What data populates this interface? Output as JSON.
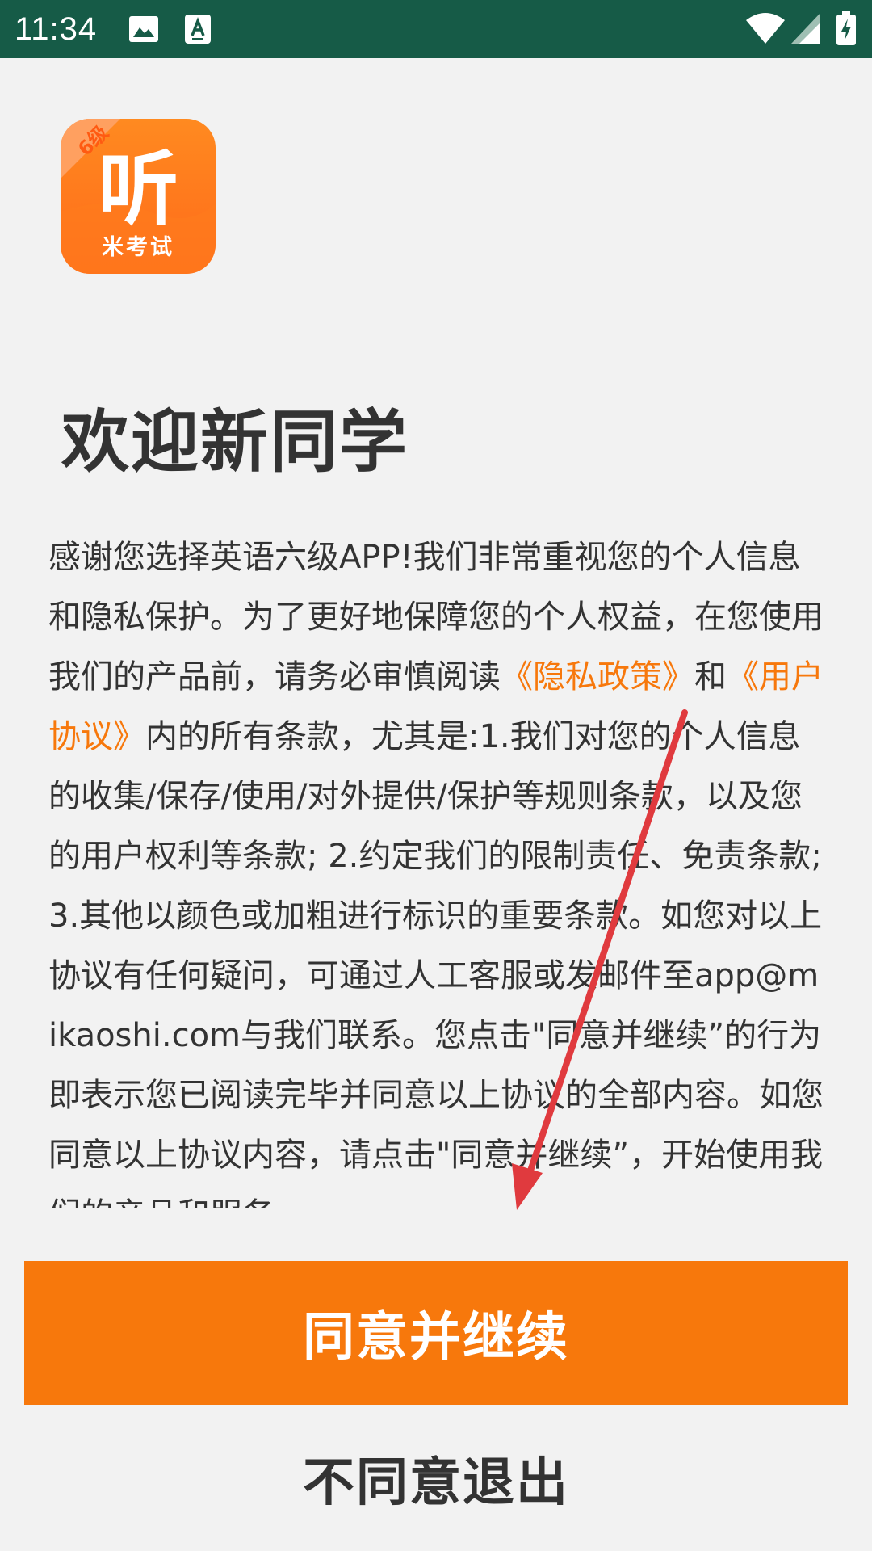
{
  "status_bar": {
    "time": "11:34",
    "icons": [
      "image-icon",
      "text-format-icon",
      "wifi-icon",
      "cellular-signal-icon",
      "battery-charging-icon"
    ]
  },
  "app": {
    "logo_icon": "listening-6-level-app-logo",
    "logo_badge": "6级",
    "logo_main": "听",
    "logo_sub": "米考试"
  },
  "welcome": {
    "title": "欢迎新同学"
  },
  "agreement": {
    "text_1": "感谢您选择英语六级APP!我们非常重视您的个人信息和隐私保护。为了更好地保障您的个人权益，在您使用我们的产品前，请务必审慎阅读",
    "privacy_link": "《隐私政策》",
    "text_2": "和",
    "user_agreement_link": "《用户协议》",
    "text_3": "内的所有条款，尤其是:1.我们对您的个人信息的收集/保存/使用/对外提供/保护等规则条款，以及您的用户权利等条款; 2.约定我们的限制责任、免责条款; 3.其他以颜色或加粗进行标识的重要条款。如您对以上协议有任何疑问，可通过人工客服或发邮件至app@mikaoshi.com与我们联系。您点击\"同意并继续”的行为即表示您已阅读完毕并同意以上协议的全部内容。如您同意以上协议内容，请点击\"同意并继续”，开始使用我们的产品和服务。"
  },
  "buttons": {
    "agree_label": "同意并继续",
    "disagree_label": "不同意退出"
  },
  "colors": {
    "status_bar": "#165b47",
    "accent": "#f7780c",
    "background": "#f2f2f2",
    "text": "#333333",
    "annotation_arrow": "#e03a3e"
  }
}
